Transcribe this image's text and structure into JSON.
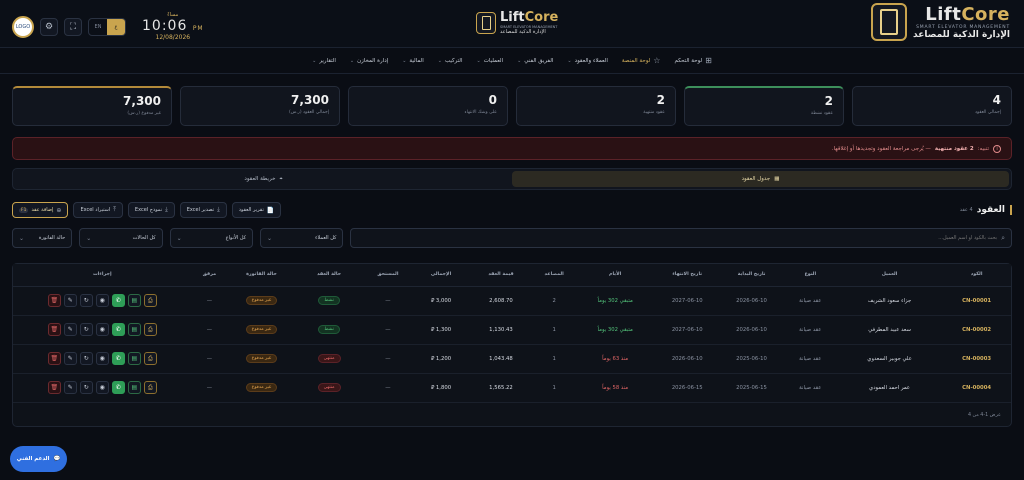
{
  "header": {
    "brand_lift": "Lift",
    "brand_core": "Core",
    "brand_sub": "SMART ELEVATOR MANAGEMENT",
    "brand_ar": "الإدارة الذكية للمصاعد",
    "center_sub": "SMART ELEVATOR MANAGEMENT",
    "center_ar": "الإدارة الذكية للمصاعد",
    "avatar_text": "LOGO",
    "lang_en": "EN",
    "lang_ar": "ع",
    "clock_label": "مساءً",
    "clock_time": "10:06",
    "clock_seconds": "PM",
    "clock_date": "12/08/2026"
  },
  "nav": [
    {
      "label": "لوحة التحكم",
      "icon": "grid-icon",
      "active": false,
      "dropdown": false
    },
    {
      "label": "لوحة المنصة",
      "icon": "star-icon",
      "active": true,
      "dropdown": false
    },
    {
      "label": "العملاء والعقود",
      "icon": "",
      "active": false,
      "dropdown": true
    },
    {
      "label": "الفريق الفني",
      "icon": "",
      "active": false,
      "dropdown": true
    },
    {
      "label": "العمليات",
      "icon": "",
      "active": false,
      "dropdown": true
    },
    {
      "label": "التركيب",
      "icon": "",
      "active": false,
      "dropdown": true
    },
    {
      "label": "المالية",
      "icon": "",
      "active": false,
      "dropdown": true
    },
    {
      "label": "إدارة المخازن",
      "icon": "",
      "active": false,
      "dropdown": true
    },
    {
      "label": "التقارير",
      "icon": "",
      "active": false,
      "dropdown": true
    }
  ],
  "stats": [
    {
      "value": "4",
      "label": "إجمالي العقود",
      "accent": "none"
    },
    {
      "value": "2",
      "label": "عقود نشطة",
      "accent": "green"
    },
    {
      "value": "2",
      "label": "عقود منتهية",
      "accent": "none"
    },
    {
      "value": "0",
      "label": "على وشك الانتهاء",
      "accent": "none"
    },
    {
      "value": "7,300",
      "label": "إجمالي العقود (ر.س)",
      "accent": "none"
    },
    {
      "value": "7,300",
      "label": "غير مدفوع (ر.س)",
      "accent": "gold"
    }
  ],
  "alert": {
    "prefix": "تنبيه:",
    "bold": "2 عقود منتهية",
    "rest": "— يُرجى مراجعة العقود وتجديدها أو إغلاقها."
  },
  "view_tabs": [
    {
      "label": "جدول العقود",
      "icon": "table-icon",
      "active": true
    },
    {
      "label": "خريطة العقود",
      "icon": "map-pin-icon",
      "active": false
    }
  ],
  "toolbar": {
    "title": "العقود",
    "count": "4 عقد",
    "buttons": [
      {
        "label": "تقرير العقود",
        "icon": "📄",
        "name": "contracts-report-button"
      },
      {
        "label": "تصدير Excel",
        "icon": "⤓",
        "name": "export-excel-button"
      },
      {
        "label": "نموذج Excel",
        "icon": "⤓",
        "name": "excel-template-button"
      },
      {
        "label": "استيراد Excel",
        "icon": "⤒",
        "name": "import-excel-button"
      }
    ],
    "add_label": "إضافة عقد",
    "add_badge": "F1"
  },
  "filters": {
    "search_placeholder": "بحث بالكود أو اسم العميل...",
    "client": "كل العملاء",
    "type": "كل الأنواع",
    "status": "كل الحالات",
    "invoice": "حالة الفاتورة"
  },
  "table": {
    "headers": [
      "الكود",
      "العميل",
      "النوع",
      "تاريخ البداية",
      "تاريخ الانتهاء",
      "الأيام",
      "المصاعد",
      "قيمة العقد",
      "الإجمالي",
      "المستحق",
      "حالة العقد",
      "حالة الفاتورة",
      "مرفق",
      "إجراءات"
    ],
    "rows": [
      {
        "code": "CN-00001",
        "client": "جزاء سعود الشريف",
        "type": "عقد صيانة",
        "start": "2026-06-10",
        "end": "2027-06-10",
        "days": "متبقي 302 يوماً",
        "days_state": "pos",
        "elevators": "2",
        "value": "2,608.70",
        "total": "3,000 ⃁",
        "due": "—",
        "status": "نشط",
        "status_state": "green",
        "invoice": "غير مدفوع",
        "attach": "—"
      },
      {
        "code": "CN-00002",
        "client": "سعد عبيد المطرفي",
        "type": "عقد صيانة",
        "start": "2026-06-10",
        "end": "2027-06-10",
        "days": "متبقي 302 يوماً",
        "days_state": "pos",
        "elevators": "1",
        "value": "1,130.43",
        "total": "1,300 ⃁",
        "due": "—",
        "status": "نشط",
        "status_state": "green",
        "invoice": "غير مدفوع",
        "attach": "—"
      },
      {
        "code": "CN-00003",
        "client": "علي جوبير السعدوي",
        "type": "عقد صيانة",
        "start": "2025-06-10",
        "end": "2026-06-10",
        "days": "منذ 63 يوماً",
        "days_state": "neg",
        "elevators": "1",
        "value": "1,043.48",
        "total": "1,200 ⃁",
        "due": "—",
        "status": "منتهي",
        "status_state": "red",
        "invoice": "غير مدفوع",
        "attach": "—"
      },
      {
        "code": "CN-00004",
        "client": "عمر احمد العمودي",
        "type": "عقد صيانة",
        "start": "2025-06-15",
        "end": "2026-06-15",
        "days": "منذ 58 يوماً",
        "days_state": "neg",
        "elevators": "1",
        "value": "1,565.22",
        "total": "1,800 ⃁",
        "due": "—",
        "status": "منتهي",
        "status_state": "red",
        "invoice": "غير مدفوع",
        "attach": "—"
      }
    ],
    "footer": "عرض 1-4 من 4"
  },
  "support": {
    "label": "الدعم الفني"
  },
  "colors": {
    "accent": "#d6b25e",
    "background": "#0a0d14",
    "success": "#53c27a",
    "danger": "#e06666",
    "support": "#2f6fe0"
  }
}
